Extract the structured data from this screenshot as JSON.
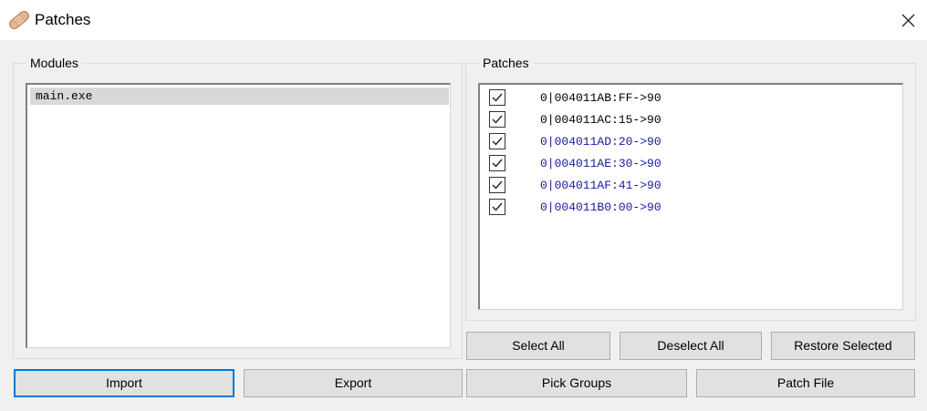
{
  "window": {
    "title": "Patches",
    "icon": "bandage-icon",
    "close_icon": "close-icon"
  },
  "modules": {
    "label": "Modules",
    "items": [
      {
        "name": "main.exe",
        "selected": true
      }
    ]
  },
  "patches": {
    "label": "Patches",
    "items": [
      {
        "text": "0|004011AB:FF->90",
        "checked": true,
        "color": "#000000"
      },
      {
        "text": "0|004011AC:15->90",
        "checked": true,
        "color": "#000000"
      },
      {
        "text": "0|004011AD:20->90",
        "checked": true,
        "color": "#1a1aa0"
      },
      {
        "text": "0|004011AE:30->90",
        "checked": true,
        "color": "#1a1aa0"
      },
      {
        "text": "0|004011AF:41->90",
        "checked": true,
        "color": "#1a1aa0"
      },
      {
        "text": "0|004011B0:00->90",
        "checked": true,
        "color": "#1a1aa0"
      }
    ]
  },
  "buttons": {
    "select_all": "Select All",
    "deselect_all": "Deselect All",
    "restore_selected": "Restore Selected",
    "import": "Import",
    "export": "Export",
    "pick_groups": "Pick Groups",
    "patch_file": "Patch File"
  },
  "colors": {
    "accent": "#0078d7",
    "highlight_row": "#d9d9d9",
    "patch_blue": "#1a1aa0"
  }
}
